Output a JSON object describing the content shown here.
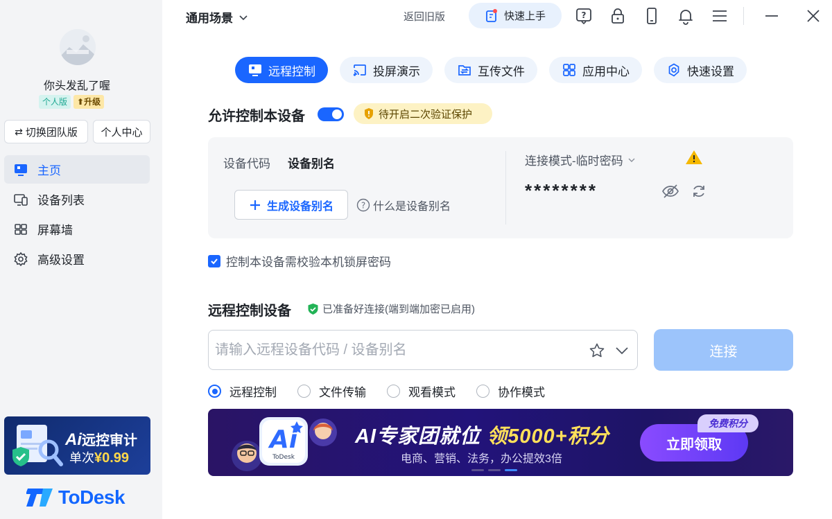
{
  "sidebar": {
    "username": "你头发乱了喔",
    "badge_personal": "个人版",
    "badge_upgrade": "升级",
    "switch_team": "切换团队版",
    "personal_center": "个人中心",
    "nav": [
      {
        "label": "主页",
        "icon": "monitor-icon",
        "active": true
      },
      {
        "label": "设备列表",
        "icon": "devices-icon",
        "active": false
      },
      {
        "label": "屏幕墙",
        "icon": "grid-icon",
        "active": false
      },
      {
        "label": "高级设置",
        "icon": "gear-icon",
        "active": false
      }
    ],
    "promo": {
      "title_ai": "Ai",
      "title_rest": "远控审计",
      "price_prefix": "单次",
      "price": "¥0.99"
    },
    "logo_text": "ToDesk"
  },
  "topbar": {
    "scene": "通用场景",
    "old_version": "返回旧版",
    "quick_start": "快速上手"
  },
  "tabs": [
    {
      "label": "远程控制",
      "icon": "screen-icon",
      "active": true
    },
    {
      "label": "投屏演示",
      "icon": "cast-icon",
      "active": false
    },
    {
      "label": "互传文件",
      "icon": "file-transfer-icon",
      "active": false
    },
    {
      "label": "应用中心",
      "icon": "apps-icon",
      "active": false
    },
    {
      "label": "快速设置",
      "icon": "gear-icon",
      "active": false
    }
  ],
  "allow": {
    "title": "允许控制本设备",
    "enabled": true,
    "warning": "待开启二次验证保护"
  },
  "device": {
    "code_label": "设备代码",
    "alias_label": "设备别名",
    "gen_alias": "生成设备别名",
    "what_alias": "什么是设备别名",
    "mode": "连接模式-临时密码",
    "password": "********"
  },
  "lock_check": {
    "label": "控制本设备需校验本机锁屏密码",
    "checked": true
  },
  "remote": {
    "title": "远程控制设备",
    "status": "已准备好连接(端到端加密已启用)",
    "placeholder": "请输入远程设备代码 / 设备别名",
    "connect": "连接",
    "modes": [
      {
        "label": "远程控制",
        "selected": true
      },
      {
        "label": "文件传输",
        "selected": false
      },
      {
        "label": "观看模式",
        "selected": false
      },
      {
        "label": "协作模式",
        "selected": false
      }
    ]
  },
  "banner": {
    "title_part1": "AI专家团就位 ",
    "title_highlight": "领5000+积分",
    "subtitle": "电商、营销、法务，办公提效3倍",
    "button": "立即领取",
    "tag": "免费积分",
    "logo_ai": "Ai",
    "logo_small": "ToDesk"
  },
  "colors": {
    "accent": "#1a66ff",
    "connect_disabled": "#9cc4fb",
    "banner_bg": "#22137a"
  }
}
